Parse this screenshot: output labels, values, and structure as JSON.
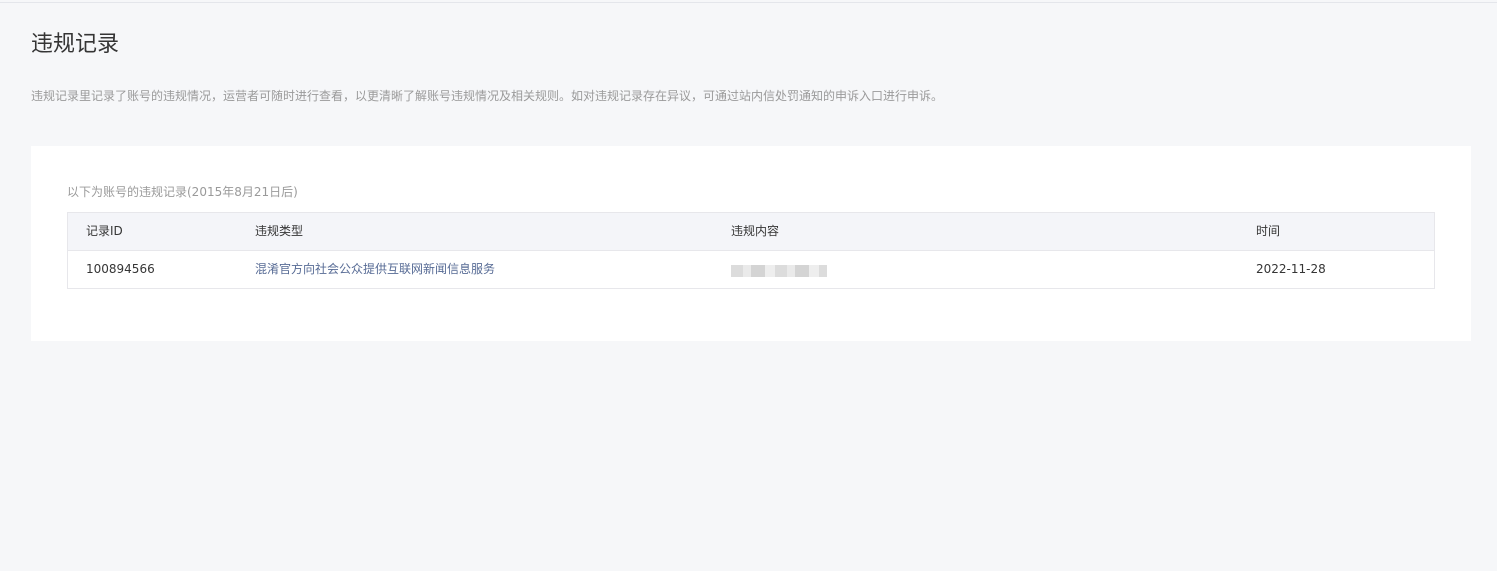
{
  "page": {
    "title": "违规记录",
    "description": "违规记录里记录了账号的违规情况，运营者可随时进行查看，以更清晰了解账号违规情况及相关规则。如对违规记录存在异议，可通过站内信处罚通知的申诉入口进行申诉。"
  },
  "records": {
    "caption": "以下为账号的违规记录(2015年8月21日后)",
    "columns": [
      "记录ID",
      "违规类型",
      "违规内容",
      "时间"
    ],
    "rows": [
      {
        "id": "100894566",
        "type": "混淆官方向社会公众提供互联网新闻信息服务",
        "content": "",
        "time": "2022-11-28"
      }
    ]
  },
  "colors": {
    "background": "#f6f7f9",
    "card": "#ffffff",
    "header_row": "#f4f5f9",
    "link_text": "#576b95",
    "muted_text": "#9a9a9a"
  }
}
